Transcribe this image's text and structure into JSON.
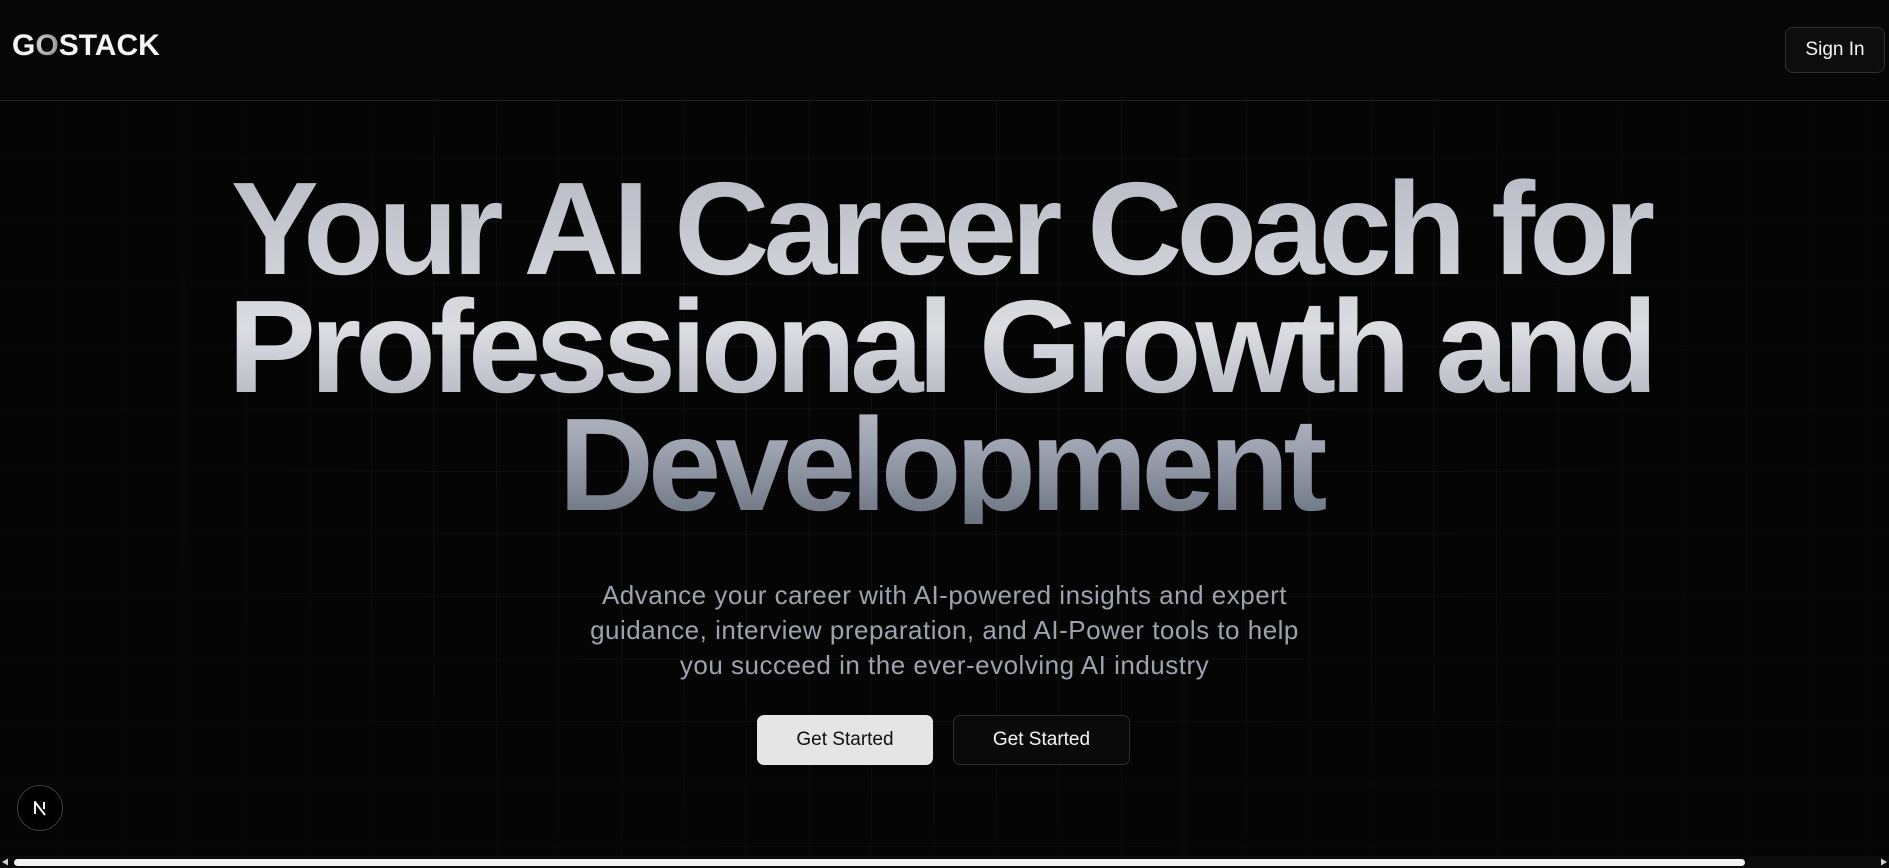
{
  "header": {
    "logo_prefix": "G",
    "logo_o": "O",
    "logo_suffix": "STACK",
    "signin_label": "Sign In"
  },
  "hero": {
    "title_line1": "Your AI Career Coach for",
    "title_line2": "Professional Growth and",
    "title_line3": "Development",
    "subtitle": "Advance your career with AI-powered insights and expert guidance, interview preparation, and AI-Power tools to help you succeed in the ever-evolving AI industry",
    "primary_cta": "Get Started",
    "secondary_cta": "Get Started"
  },
  "badge": {
    "letter": "N"
  },
  "scrollbar": {
    "position_fraction": 0.0,
    "visible_fraction": 0.93
  },
  "icons": {
    "badge": "nextjs-logo-icon",
    "scroll_left": "triangle-left-icon",
    "scroll_right": "triangle-right-icon"
  },
  "colors": {
    "background": "#050505",
    "title_gradient_top": "#b9bcc6",
    "title_gradient_bottom": "#6b7280",
    "subtitle": "#9ca3af",
    "primary_button": "#e5e5e5"
  }
}
